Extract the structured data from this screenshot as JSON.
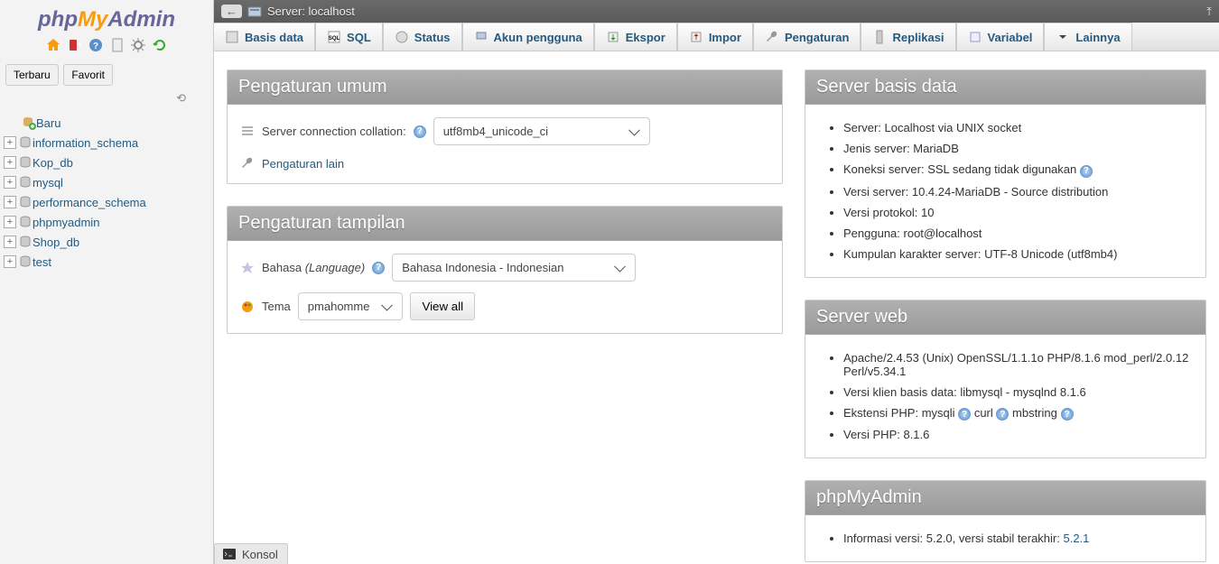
{
  "logo": {
    "p1": "php",
    "p2": "My",
    "p3": "Admin"
  },
  "server_bar": {
    "label": "Server: localhost"
  },
  "sidebar": {
    "tabs": [
      "Terbaru",
      "Favorit"
    ],
    "new_label": "Baru",
    "databases": [
      "information_schema",
      "Kop_db",
      "mysql",
      "performance_schema",
      "phpmyadmin",
      "Shop_db",
      "test"
    ]
  },
  "nav": [
    {
      "label": "Basis data",
      "name": "nav-databases"
    },
    {
      "label": "SQL",
      "name": "nav-sql"
    },
    {
      "label": "Status",
      "name": "nav-status"
    },
    {
      "label": "Akun pengguna",
      "name": "nav-users"
    },
    {
      "label": "Ekspor",
      "name": "nav-export"
    },
    {
      "label": "Impor",
      "name": "nav-import"
    },
    {
      "label": "Pengaturan",
      "name": "nav-settings"
    },
    {
      "label": "Replikasi",
      "name": "nav-replication"
    },
    {
      "label": "Variabel",
      "name": "nav-variables"
    },
    {
      "label": "Lainnya",
      "name": "nav-more"
    }
  ],
  "general": {
    "title": "Pengaturan umum",
    "collation_label": "Server connection collation:",
    "collation_value": "utf8mb4_unicode_ci",
    "more_link": "Pengaturan lain"
  },
  "appearance": {
    "title": "Pengaturan tampilan",
    "lang_label": "Bahasa",
    "lang_paren": "(Language)",
    "lang_value": "Bahasa Indonesia - Indonesian",
    "theme_label": "Tema",
    "theme_value": "pmahomme",
    "view_all": "View all"
  },
  "db_server": {
    "title": "Server basis data",
    "items": [
      "Server: Localhost via UNIX socket",
      "Jenis server: MariaDB",
      "Koneksi server: SSL sedang tidak digunakan",
      "Versi server: 10.4.24-MariaDB - Source distribution",
      "Versi protokol: 10",
      "Pengguna: root@localhost",
      "Kumpulan karakter server: UTF-8 Unicode (utf8mb4)"
    ],
    "help_after_index": 2
  },
  "web_server": {
    "title": "Server web",
    "apache": "Apache/2.4.53 (Unix) OpenSSL/1.1.1o PHP/8.1.6 mod_perl/2.0.12 Perl/v5.34.1",
    "client": "Versi klien basis data: libmysql - mysqlnd 8.1.6",
    "ext_label": "Ekstensi PHP:",
    "exts": [
      "mysqli",
      "curl",
      "mbstring"
    ],
    "php": "Versi PHP: 8.1.6"
  },
  "pma": {
    "title": "phpMyAdmin",
    "version_label": "Informasi versi: 5.2.0, versi stabil terakhir:",
    "version_link": "5.2.1"
  },
  "konsol": "Konsol"
}
